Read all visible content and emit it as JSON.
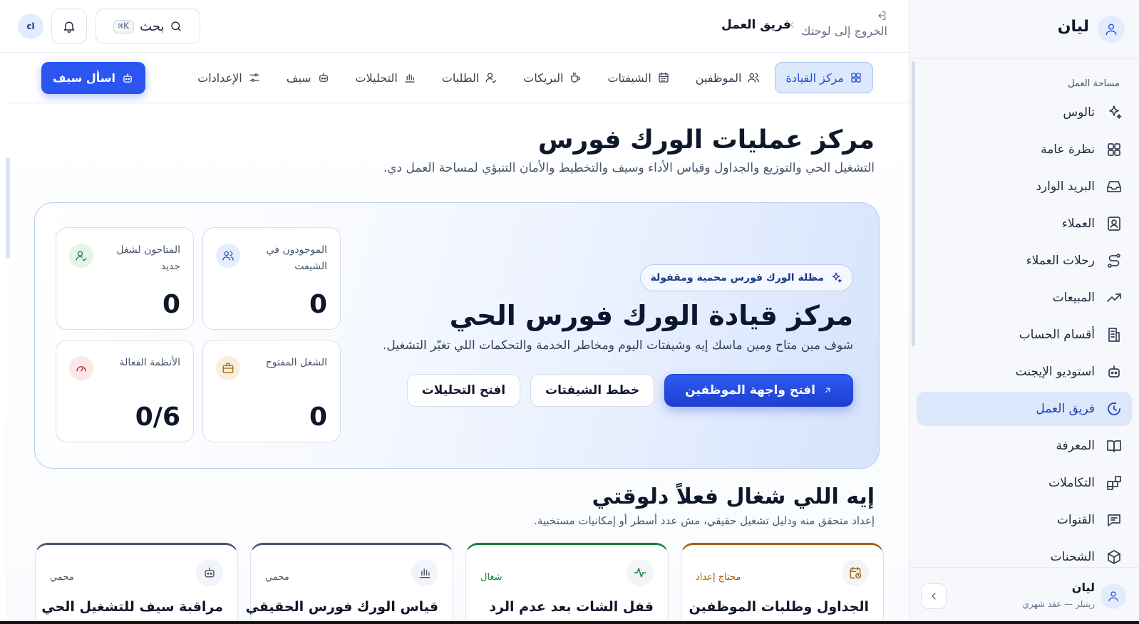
{
  "sidebar": {
    "workspace_name": "ليان",
    "section_label": "مساحة العمل",
    "items": [
      {
        "label": "تالوس",
        "icon": "sparkles-icon"
      },
      {
        "label": "نظرة عامة",
        "icon": "grid-icon"
      },
      {
        "label": "البريد الوارد",
        "icon": "inbox-icon"
      },
      {
        "label": "العملاء",
        "icon": "contact-icon"
      },
      {
        "label": "رحلات العملاء",
        "icon": "route-icon"
      },
      {
        "label": "المبيعات",
        "icon": "trending-up-icon"
      },
      {
        "label": "أقسام الحساب",
        "icon": "building-icon"
      },
      {
        "label": "استوديو الإيجنت",
        "icon": "bot-icon"
      },
      {
        "label": "فريق العمل",
        "icon": "clock-icon",
        "active": true
      },
      {
        "label": "المعرفة",
        "icon": "book-icon"
      },
      {
        "label": "التكاملات",
        "icon": "blocks-icon"
      },
      {
        "label": "القنوات",
        "icon": "message-icon"
      },
      {
        "label": "الشحنات",
        "icon": "package-icon"
      }
    ],
    "footer": {
      "name": "ليان",
      "plan": "ريتيلر — عقد شهري"
    }
  },
  "topbar": {
    "back_label": "الخروج إلى لوحتك",
    "crumb": "فريق العمل",
    "search_label": "بحث",
    "search_kbd": "K⌘",
    "user_initials": "cl"
  },
  "tabs": [
    {
      "label": "مركز القيادة",
      "icon": "layout-grid-icon",
      "active": true
    },
    {
      "label": "الموظفين",
      "icon": "users-icon"
    },
    {
      "label": "الشيفتات",
      "icon": "calendar-icon"
    },
    {
      "label": "البريكات",
      "icon": "coffee-icon"
    },
    {
      "label": "الطلبات",
      "icon": "user-check-icon"
    },
    {
      "label": "التحليلات",
      "icon": "bar-chart-icon"
    },
    {
      "label": "سيف",
      "icon": "bot-icon"
    },
    {
      "label": "الإعدادات",
      "icon": "sliders-icon"
    }
  ],
  "ask_button": "اسأل سيف",
  "page": {
    "title": "مركز عمليات الورك فورس",
    "subtitle": "التشغيل الحي والتوزيع والجداول وقياس الأداء وسيف والتخطيط والأمان التنبؤي لمساحة العمل دي."
  },
  "hero": {
    "badge": "مظلة الورك فورس محمية ومقفولة",
    "title": "مركز قيادة الورك فورس الحي",
    "subtitle": "شوف مين متاح ومين ماسك إيه وشيفتات اليوم ومخاطر الخدمة والتحكمات اللي تغيّر التشغيل.",
    "primary_button": "افتح واجهة الموظفين",
    "secondary_button": "خطط الشيفتات",
    "tertiary_button": "افتح التحليلات",
    "stats": [
      {
        "label": "الموجودون في الشيفت",
        "value": "0",
        "icon": "users-icon",
        "color": "#1d4ed8",
        "bg": "#e6eefc"
      },
      {
        "label": "المتاحون لشغل جديد",
        "value": "0",
        "icon": "user-check-icon",
        "color": "#15803d",
        "bg": "#e6f4ea"
      },
      {
        "label": "الشغل المفتوح",
        "value": "0",
        "icon": "briefcase-icon",
        "color": "#a16207",
        "bg": "#f7eedd"
      },
      {
        "label": "الأنظمة الفعالة",
        "value": "0/6",
        "icon": "gauge-icon",
        "color": "#b91c1c",
        "bg": "#fbe7e7"
      }
    ]
  },
  "section": {
    "title": "إيه اللي شغال فعلاً دلوقتي",
    "subtitle": "إعداد متحقق منه ودليل تشغيل حقيقي، مش عدد أسطر أو إمكانيات مستخبية."
  },
  "cards": [
    {
      "title": "الجداول وطلبات الموظفين",
      "status": "محتاج إعداد",
      "icon": "calendar-clock-icon",
      "color": "#a16207"
    },
    {
      "title": "قفل الشات بعد عدم الرد",
      "status": "شغال",
      "icon": "activity-icon",
      "color": "#15803d"
    },
    {
      "title": "قياس الورك فورس الحقيقي",
      "status": "محمي",
      "icon": "bar-chart-icon",
      "color": "#475569"
    },
    {
      "title": "مراقبة سيف للتشغيل الحي",
      "status": "محمي",
      "icon": "bot-icon",
      "color": "#475569"
    }
  ]
}
